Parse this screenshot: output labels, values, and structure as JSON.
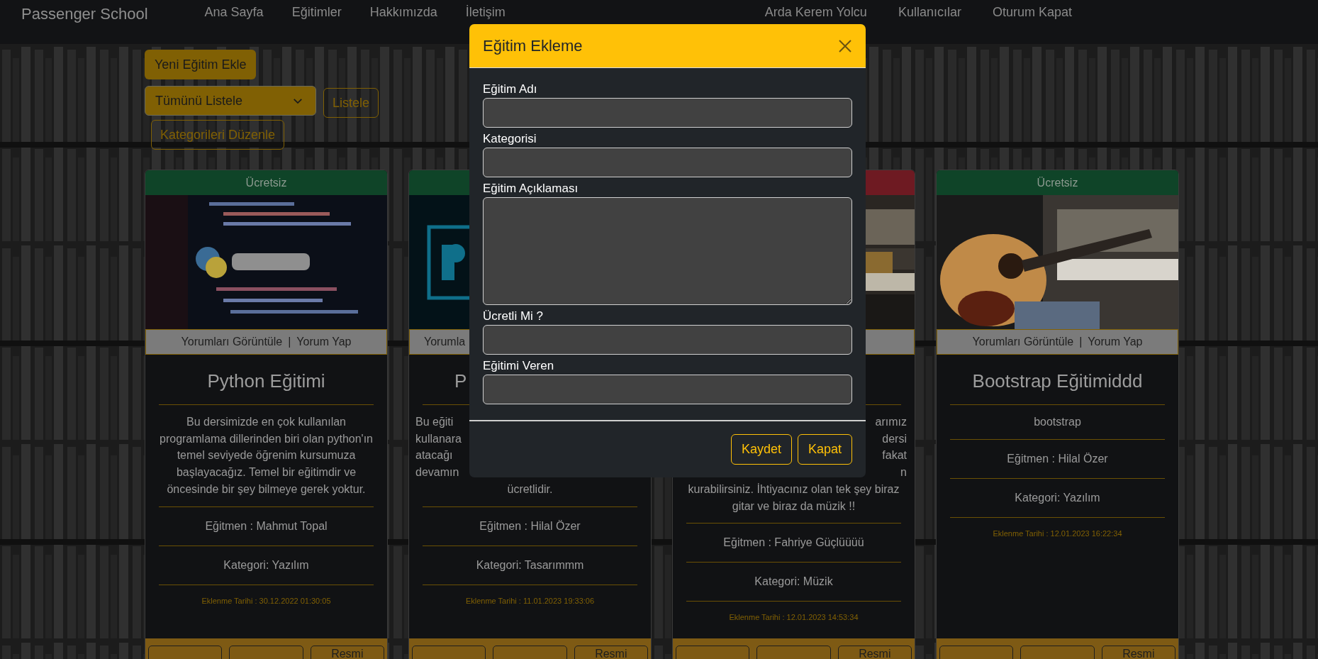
{
  "navbar": {
    "brand": "Passenger School",
    "links": [
      {
        "label": "Ana Sayfa"
      },
      {
        "label": "Eğitimler"
      },
      {
        "label": "Hakkımızda"
      },
      {
        "label": "İletişim"
      }
    ],
    "user_links": [
      {
        "label": "Arda Kerem Yolcu"
      },
      {
        "label": "Kullanıcılar"
      },
      {
        "label": "Oturum Kapat"
      }
    ]
  },
  "toolbar": {
    "add_button": "Yeni Eğitim Ekle",
    "filter_select": {
      "value": "Tümünü Listele"
    },
    "list_button": "Listele",
    "categories_button": "Kategorileri Düzenle"
  },
  "cards": [
    {
      "color": "#0f4428",
      "price_label": "Ücretsiz",
      "picture": {
        "kind": "picture"
      },
      "comments": {
        "view": "Yorumları Görüntüle",
        "separator": "|",
        "write": "Yorum Yap"
      },
      "title": "Python Eğitimi",
      "description": "Bu dersimizde en çok kullanılan programlama dillerinden biri olan python'ın temel seviyede öğrenim kursumuza başlayacağız. Temel bir eğitimdir ve öncesinde bir şey bilmeye gerek yoktur.",
      "instructor": "Eğitmen : Mahmut Topal",
      "category": "Kategori: Yazılım",
      "date": "Eklenme Tarihi : 30.12.2022 01:30:05",
      "image_button": {
        "label": "Resmi"
      }
    },
    {
      "color": "#0f4428",
      "hidden_right": true,
      "picture": {
        "kind": "picture"
      },
      "comments": {
        "view": "Yorumla"
      },
      "title": "P",
      "description_lines": [
        {
          "text": "Bu eğiti",
          "cut": true
        },
        {
          "text": "kullanara",
          "cut": true
        },
        {
          "text": "atacağı",
          "cut": true
        },
        {
          "text": "devamın",
          "cut": true
        },
        {
          "text": "ücretlidir.",
          "cut": false
        }
      ],
      "instructor": "Eğitmen : Hilal Özer",
      "category": "Kategori: Tasarımmm",
      "date": "Eklenme Tarihi : 11.01.2023 19:33:06",
      "image_button": {
        "label": "Resmi"
      }
    },
    {
      "color": "#6e1a22",
      "hidden_left": true,
      "picture": {
        "kind": "picture"
      },
      "description_lines": [
        {
          "text": "arımız",
          "cut": true
        },
        {
          "text": "dersi",
          "cut": true
        },
        {
          "text": "fakat",
          "cut": true
        },
        {
          "text": "n",
          "cut": true
        },
        {
          "text": "kurabilirsiniz. İhtiyacınız olan tek şey biraz",
          "cut": false
        },
        {
          "text": "gitar ve biraz da müzik !!",
          "cut": false
        }
      ],
      "instructor": "Eğitmen : Fahriye Güçlüüüü",
      "category": "Kategori: Müzik",
      "date": "Eklenme Tarihi : 12.01.2023 14:53:34",
      "image_button": {
        "label": "Resmi"
      }
    },
    {
      "color": "#0f4428",
      "price_label": "Ücretsiz",
      "picture": {
        "kind": "picture"
      },
      "comments": {
        "view": "Yorumları Görüntüle",
        "separator": "|",
        "write": "Yorum Yap"
      },
      "title": "Bootstrap Eğitimiddd",
      "description": "bootstrap",
      "instructor": "Eğitmen : Hilal Özer",
      "category": "Kategori: Yazılım",
      "date": "Eklenme Tarihi : 12.01.2023 16:22:34",
      "image_button": {
        "label": "Resmi"
      }
    }
  ],
  "modal": {
    "title": "Eğitim Ekleme",
    "fields": [
      {
        "label": "Eğitim Adı",
        "kind": "input"
      },
      {
        "label": "Kategorisi",
        "kind": "input"
      },
      {
        "label": "Eğitim Açıklaması",
        "kind": "textarea"
      },
      {
        "label": "Ücretli Mi ?",
        "kind": "input"
      },
      {
        "label": "Eğitimi Veren",
        "kind": "input"
      }
    ],
    "buttons": [
      {
        "label": "Kaydet"
      },
      {
        "label": "Kapat"
      }
    ]
  }
}
